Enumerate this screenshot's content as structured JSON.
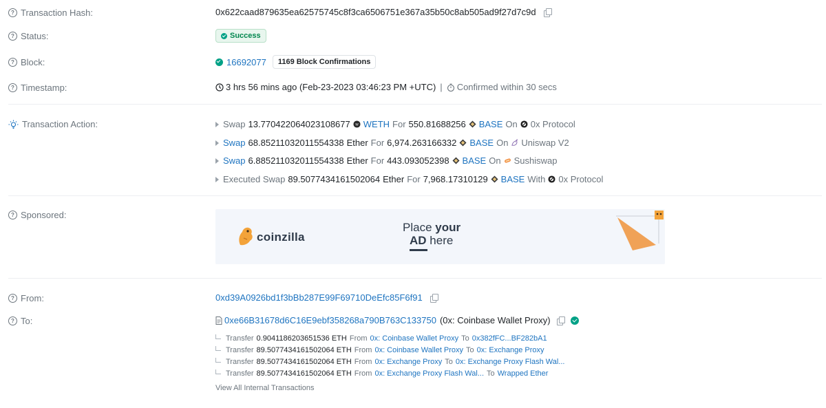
{
  "labels": {
    "tx_hash": "Transaction Hash:",
    "status": "Status:",
    "block": "Block:",
    "timestamp": "Timestamp:",
    "tx_action": "Transaction Action:",
    "sponsored": "Sponsored:",
    "from": "From:",
    "to": "To:"
  },
  "tx_hash": "0x622caad879635ea62575745c8f3ca6506751e367a35b50c8ab505ad9f27d7c9d",
  "status": "Success",
  "block": {
    "number": "16692077",
    "confirmations": "1169 Block Confirmations"
  },
  "timestamp": {
    "text": "3 hrs 56 mins ago (Feb-23-2023 03:46:23 PM +UTC)",
    "separator": "|",
    "confirmed": "Confirmed within 30 secs"
  },
  "actions": [
    {
      "verb": "Swap",
      "verb_link": false,
      "amount": "13.770422064023108677",
      "token_in": "WETH",
      "token_in_link": true,
      "for": "For",
      "amount_out": "550.81688256",
      "token_out": "BASE",
      "prep": "On",
      "venue": "0x Protocol"
    },
    {
      "verb": "Swap",
      "verb_link": true,
      "amount": "68.85211032011554338",
      "token_in": "Ether",
      "token_in_link": false,
      "for": "For",
      "amount_out": "6,974.263166332",
      "token_out": "BASE",
      "prep": "On",
      "venue": "Uniswap V2"
    },
    {
      "verb": "Swap",
      "verb_link": true,
      "amount": "6.885211032011554338",
      "token_in": "Ether",
      "token_in_link": false,
      "for": "For",
      "amount_out": "443.093052398",
      "token_out": "BASE",
      "prep": "On",
      "venue": "Sushiswap"
    },
    {
      "verb": "Executed Swap",
      "verb_link": false,
      "amount": "89.5077434161502064",
      "token_in": "Ether",
      "token_in_link": false,
      "for": "For",
      "amount_out": "7,968.17310129",
      "token_out": "BASE",
      "prep": "With",
      "venue": "0x Protocol"
    }
  ],
  "ad": {
    "brand": "coinzilla",
    "line1_a": "Place ",
    "line1_b": "your",
    "line2_a": "AD",
    "line2_b": " here"
  },
  "from": "0xd39A0926bd1f3bBb287E99F69710DeEfc85F6f91",
  "to": {
    "address": "0xe66B31678d6C16E9ebf358268a790B763C133750",
    "name": "(0x: Coinbase Wallet Proxy)"
  },
  "transfers": [
    {
      "label": "Transfer",
      "amount": "0.9041186203651536 ETH",
      "from_word": "From",
      "from": "0x: Coinbase Wallet Proxy",
      "to_word": "To",
      "to": "0x382fFC...BF282bA1"
    },
    {
      "label": "Transfer",
      "amount": "89.5077434161502064 ETH",
      "from_word": "From",
      "from": "0x: Coinbase Wallet Proxy",
      "to_word": "To",
      "to": "0x: Exchange Proxy"
    },
    {
      "label": "Transfer",
      "amount": "89.5077434161502064 ETH",
      "from_word": "From",
      "from": "0x: Exchange Proxy",
      "to_word": "To",
      "to": "0x: Exchange Proxy Flash Wal..."
    },
    {
      "label": "Transfer",
      "amount": "89.5077434161502064 ETH",
      "from_word": "From",
      "from": "0x: Exchange Proxy Flash Wal...",
      "to_word": "To",
      "to": "Wrapped Ether"
    }
  ],
  "view_all": "View All Internal Transactions",
  "colors": {
    "link": "#1e74c0",
    "success": "#00a186",
    "muted": "#6c757d"
  }
}
